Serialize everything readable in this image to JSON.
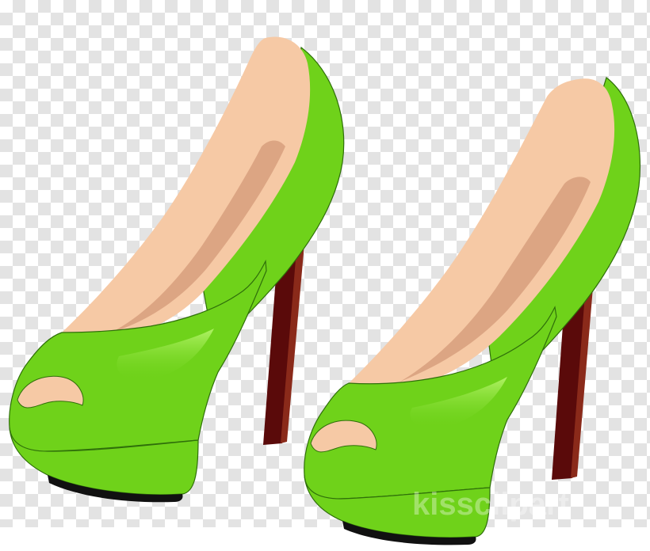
{
  "image": {
    "subject": "pair-of-green-peep-toe-high-heels",
    "background": "transparency-checkerboard"
  },
  "colors": {
    "upper": "#6fd21a",
    "upper_shadow": "#4fa80f",
    "upper_highlight": "#b4f56a",
    "outline": "#2f6f0a",
    "lining": "#f6c9a5",
    "lining_shadow": "#dca583",
    "heel": "#5a0a0a",
    "heel_edge": "#8a2a1a",
    "sole": "#111111",
    "checker_light": "#ffffff",
    "checker_dark": "#e3e3e3"
  },
  "watermark": {
    "text": "kissclipart"
  }
}
